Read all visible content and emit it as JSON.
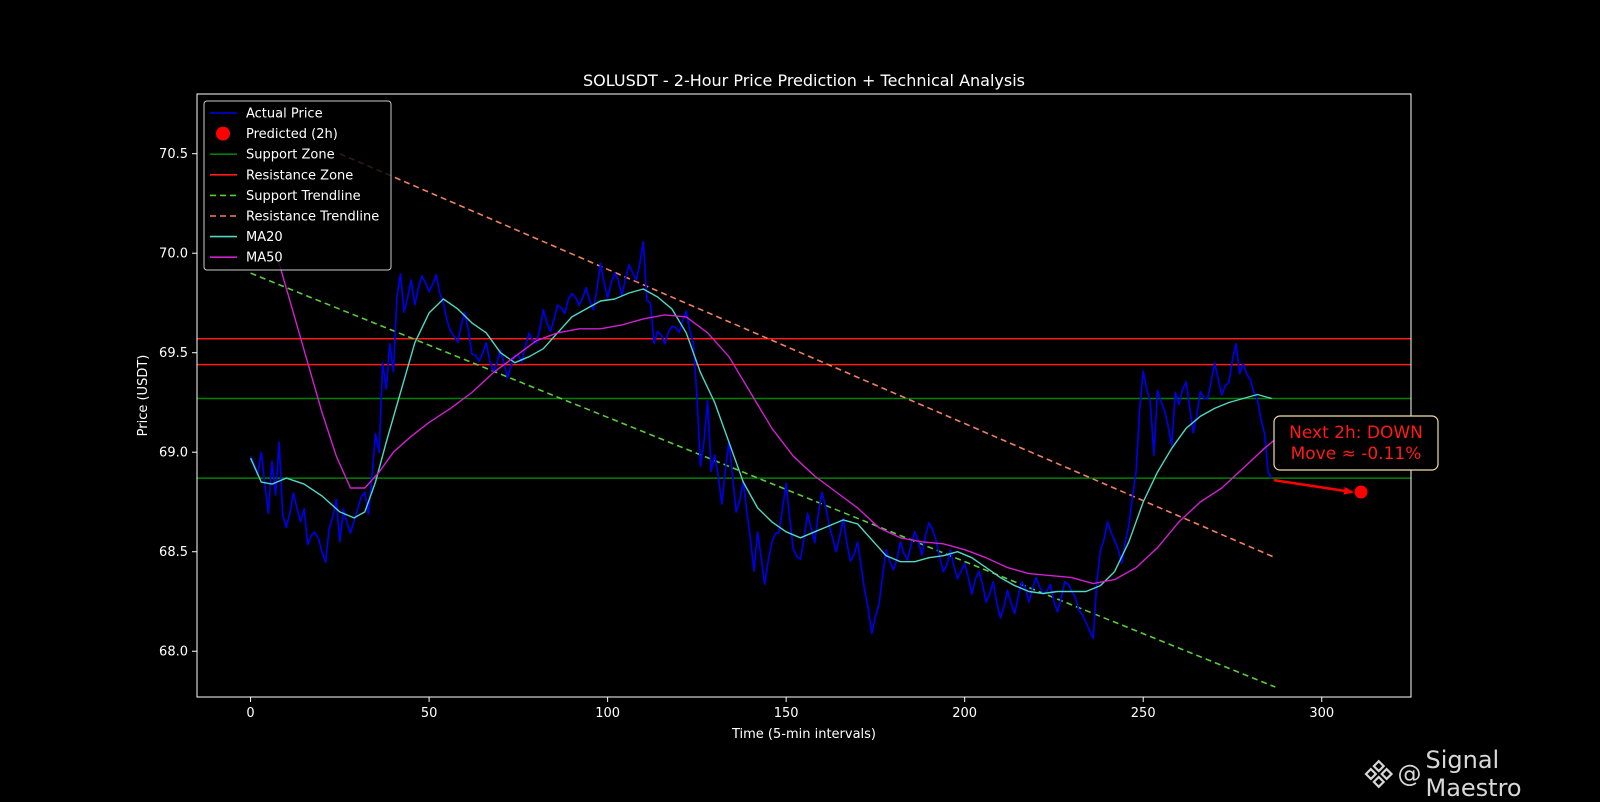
{
  "chart_data": {
    "type": "line",
    "title": "SOLUSDT - 2-Hour Price Prediction + Technical Analysis",
    "xlabel": "Time (5-min intervals)",
    "ylabel": "Price (USDT)",
    "xlim": [
      -15,
      325
    ],
    "ylim": [
      67.77,
      70.8
    ],
    "xticks": [
      0,
      50,
      100,
      150,
      200,
      250,
      300
    ],
    "yticks": [
      68.0,
      68.5,
      69.0,
      69.5,
      70.0,
      70.5
    ],
    "ytick_labels": [
      "68.0",
      "68.5",
      "69.0",
      "69.5",
      "70.0",
      "70.5"
    ],
    "grid": false,
    "legend_position": "top-left",
    "legend": [
      "Actual Price",
      "Predicted (2h)",
      "Support Zone",
      "Resistance Zone",
      "Support Trendline",
      "Resistance Trendline",
      "MA20",
      "MA50"
    ],
    "colors": {
      "actual": "#0000e6",
      "predicted": "#ff0000",
      "support_zone": "#008000",
      "resistance_zone": "#ff1a1a",
      "support_trend": "#5acb3c",
      "resistance_trend": "#f08060",
      "ma20": "#4fd8c4",
      "ma50": "#d020d0"
    },
    "actual_price_anchors": [
      [
        0,
        68.97
      ],
      [
        2,
        68.9
      ],
      [
        3,
        69.0
      ],
      [
        4,
        68.85
      ],
      [
        5,
        68.68
      ],
      [
        6,
        68.95
      ],
      [
        7,
        68.78
      ],
      [
        8,
        69.05
      ],
      [
        9,
        68.7
      ],
      [
        10,
        68.62
      ],
      [
        12,
        68.78
      ],
      [
        14,
        68.65
      ],
      [
        15,
        68.72
      ],
      [
        16,
        68.55
      ],
      [
        18,
        68.6
      ],
      [
        20,
        68.5
      ],
      [
        21,
        68.45
      ],
      [
        22,
        68.62
      ],
      [
        24,
        68.75
      ],
      [
        25,
        68.55
      ],
      [
        26,
        68.7
      ],
      [
        28,
        68.6
      ],
      [
        30,
        68.72
      ],
      [
        32,
        68.8
      ],
      [
        33,
        68.68
      ],
      [
        35,
        69.1
      ],
      [
        36,
        69.0
      ],
      [
        37,
        69.45
      ],
      [
        38,
        69.3
      ],
      [
        39,
        69.55
      ],
      [
        40,
        69.4
      ],
      [
        41,
        69.8
      ],
      [
        42,
        69.9
      ],
      [
        43,
        69.7
      ],
      [
        45,
        69.85
      ],
      [
        46,
        69.75
      ],
      [
        48,
        69.9
      ],
      [
        50,
        69.8
      ],
      [
        52,
        69.88
      ],
      [
        54,
        69.75
      ],
      [
        56,
        69.6
      ],
      [
        58,
        69.55
      ],
      [
        60,
        69.72
      ],
      [
        62,
        69.5
      ],
      [
        64,
        69.45
      ],
      [
        66,
        69.55
      ],
      [
        68,
        69.4
      ],
      [
        70,
        69.5
      ],
      [
        72,
        69.38
      ],
      [
        74,
        69.5
      ],
      [
        76,
        69.45
      ],
      [
        78,
        69.6
      ],
      [
        80,
        69.55
      ],
      [
        82,
        69.7
      ],
      [
        84,
        69.6
      ],
      [
        86,
        69.75
      ],
      [
        88,
        69.7
      ],
      [
        90,
        69.8
      ],
      [
        92,
        69.75
      ],
      [
        94,
        69.82
      ],
      [
        96,
        69.7
      ],
      [
        98,
        69.95
      ],
      [
        100,
        69.78
      ],
      [
        102,
        69.9
      ],
      [
        104,
        69.8
      ],
      [
        106,
        69.95
      ],
      [
        108,
        69.85
      ],
      [
        110,
        70.05
      ],
      [
        111,
        69.78
      ],
      [
        112,
        69.75
      ],
      [
        113,
        69.55
      ],
      [
        114,
        69.6
      ],
      [
        116,
        69.55
      ],
      [
        118,
        69.65
      ],
      [
        120,
        69.6
      ],
      [
        122,
        69.7
      ],
      [
        124,
        69.55
      ],
      [
        125,
        69.3
      ],
      [
        126,
        68.92
      ],
      [
        127,
        69.05
      ],
      [
        128,
        69.25
      ],
      [
        129,
        68.9
      ],
      [
        130,
        69.0
      ],
      [
        132,
        68.75
      ],
      [
        134,
        69.05
      ],
      [
        136,
        68.7
      ],
      [
        138,
        68.85
      ],
      [
        140,
        68.55
      ],
      [
        141,
        68.4
      ],
      [
        142,
        68.6
      ],
      [
        144,
        68.35
      ],
      [
        146,
        68.55
      ],
      [
        148,
        68.6
      ],
      [
        150,
        68.85
      ],
      [
        152,
        68.5
      ],
      [
        154,
        68.45
      ],
      [
        156,
        68.7
      ],
      [
        158,
        68.55
      ],
      [
        160,
        68.8
      ],
      [
        162,
        68.65
      ],
      [
        164,
        68.5
      ],
      [
        166,
        68.65
      ],
      [
        168,
        68.45
      ],
      [
        170,
        68.55
      ],
      [
        172,
        68.3
      ],
      [
        174,
        68.1
      ],
      [
        176,
        68.25
      ],
      [
        178,
        68.5
      ],
      [
        180,
        68.4
      ],
      [
        182,
        68.55
      ],
      [
        184,
        68.45
      ],
      [
        186,
        68.6
      ],
      [
        188,
        68.5
      ],
      [
        190,
        68.65
      ],
      [
        192,
        68.55
      ],
      [
        194,
        68.4
      ],
      [
        196,
        68.5
      ],
      [
        198,
        68.35
      ],
      [
        200,
        68.45
      ],
      [
        202,
        68.3
      ],
      [
        204,
        68.4
      ],
      [
        206,
        68.25
      ],
      [
        208,
        68.35
      ],
      [
        210,
        68.15
      ],
      [
        212,
        68.3
      ],
      [
        214,
        68.2
      ],
      [
        216,
        68.35
      ],
      [
        218,
        68.25
      ],
      [
        220,
        68.38
      ],
      [
        222,
        68.28
      ],
      [
        224,
        68.32
      ],
      [
        226,
        68.2
      ],
      [
        228,
        68.35
      ],
      [
        230,
        68.3
      ],
      [
        232,
        68.22
      ],
      [
        234,
        68.15
      ],
      [
        236,
        68.05
      ],
      [
        237,
        68.35
      ],
      [
        238,
        68.5
      ],
      [
        240,
        68.65
      ],
      [
        242,
        68.55
      ],
      [
        244,
        68.45
      ],
      [
        246,
        68.65
      ],
      [
        248,
        68.9
      ],
      [
        249,
        69.2
      ],
      [
        250,
        69.4
      ],
      [
        252,
        69.25
      ],
      [
        253,
        69.0
      ],
      [
        254,
        69.3
      ],
      [
        256,
        69.2
      ],
      [
        258,
        69.05
      ],
      [
        259,
        69.3
      ],
      [
        260,
        69.25
      ],
      [
        262,
        69.35
      ],
      [
        264,
        69.1
      ],
      [
        266,
        69.3
      ],
      [
        268,
        69.25
      ],
      [
        270,
        69.45
      ],
      [
        272,
        69.3
      ],
      [
        274,
        69.35
      ],
      [
        276,
        69.55
      ],
      [
        277,
        69.4
      ],
      [
        278,
        69.45
      ],
      [
        280,
        69.35
      ],
      [
        282,
        69.25
      ],
      [
        284,
        69.1
      ],
      [
        285,
        68.9
      ],
      [
        286,
        68.87
      ]
    ],
    "ma20_anchors": [
      [
        0,
        68.97
      ],
      [
        3,
        68.85
      ],
      [
        6,
        68.84
      ],
      [
        10,
        68.87
      ],
      [
        15,
        68.84
      ],
      [
        20,
        68.78
      ],
      [
        25,
        68.7
      ],
      [
        29,
        68.67
      ],
      [
        32,
        68.7
      ],
      [
        35,
        68.85
      ],
      [
        38,
        69.05
      ],
      [
        42,
        69.3
      ],
      [
        46,
        69.55
      ],
      [
        50,
        69.7
      ],
      [
        54,
        69.77
      ],
      [
        58,
        69.72
      ],
      [
        62,
        69.65
      ],
      [
        66,
        69.6
      ],
      [
        70,
        69.5
      ],
      [
        74,
        69.45
      ],
      [
        78,
        69.48
      ],
      [
        82,
        69.52
      ],
      [
        86,
        69.6
      ],
      [
        90,
        69.68
      ],
      [
        94,
        69.72
      ],
      [
        98,
        69.76
      ],
      [
        102,
        69.77
      ],
      [
        106,
        69.8
      ],
      [
        110,
        69.82
      ],
      [
        114,
        69.78
      ],
      [
        118,
        69.72
      ],
      [
        122,
        69.6
      ],
      [
        126,
        69.4
      ],
      [
        130,
        69.25
      ],
      [
        134,
        69.05
      ],
      [
        138,
        68.85
      ],
      [
        142,
        68.72
      ],
      [
        146,
        68.65
      ],
      [
        150,
        68.6
      ],
      [
        154,
        68.57
      ],
      [
        158,
        68.6
      ],
      [
        162,
        68.63
      ],
      [
        166,
        68.66
      ],
      [
        170,
        68.64
      ],
      [
        174,
        68.56
      ],
      [
        178,
        68.48
      ],
      [
        182,
        68.45
      ],
      [
        186,
        68.45
      ],
      [
        190,
        68.47
      ],
      [
        194,
        68.48
      ],
      [
        198,
        68.5
      ],
      [
        202,
        68.47
      ],
      [
        206,
        68.42
      ],
      [
        210,
        68.37
      ],
      [
        214,
        68.33
      ],
      [
        218,
        68.3
      ],
      [
        222,
        68.29
      ],
      [
        226,
        68.3
      ],
      [
        230,
        68.3
      ],
      [
        234,
        68.3
      ],
      [
        238,
        68.33
      ],
      [
        242,
        68.4
      ],
      [
        246,
        68.55
      ],
      [
        250,
        68.75
      ],
      [
        254,
        68.9
      ],
      [
        258,
        69.02
      ],
      [
        262,
        69.12
      ],
      [
        266,
        69.18
      ],
      [
        270,
        69.22
      ],
      [
        274,
        69.25
      ],
      [
        278,
        69.27
      ],
      [
        282,
        69.29
      ],
      [
        286,
        69.27
      ]
    ],
    "ma50_anchors": [
      [
        8,
        69.95
      ],
      [
        12,
        69.7
      ],
      [
        16,
        69.45
      ],
      [
        20,
        69.2
      ],
      [
        24,
        68.98
      ],
      [
        28,
        68.82
      ],
      [
        32,
        68.82
      ],
      [
        36,
        68.9
      ],
      [
        40,
        69.0
      ],
      [
        45,
        69.08
      ],
      [
        50,
        69.15
      ],
      [
        56,
        69.22
      ],
      [
        62,
        69.3
      ],
      [
        68,
        69.4
      ],
      [
        74,
        69.48
      ],
      [
        80,
        69.56
      ],
      [
        86,
        69.6
      ],
      [
        92,
        69.62
      ],
      [
        98,
        69.62
      ],
      [
        104,
        69.64
      ],
      [
        110,
        69.67
      ],
      [
        116,
        69.69
      ],
      [
        122,
        69.68
      ],
      [
        128,
        69.6
      ],
      [
        134,
        69.48
      ],
      [
        140,
        69.3
      ],
      [
        146,
        69.12
      ],
      [
        152,
        68.98
      ],
      [
        158,
        68.88
      ],
      [
        164,
        68.8
      ],
      [
        170,
        68.72
      ],
      [
        176,
        68.62
      ],
      [
        182,
        68.57
      ],
      [
        188,
        68.55
      ],
      [
        194,
        68.54
      ],
      [
        200,
        68.51
      ],
      [
        206,
        68.47
      ],
      [
        212,
        68.42
      ],
      [
        218,
        68.39
      ],
      [
        224,
        68.38
      ],
      [
        230,
        68.37
      ],
      [
        236,
        68.34
      ],
      [
        242,
        68.36
      ],
      [
        248,
        68.42
      ],
      [
        254,
        68.52
      ],
      [
        260,
        68.65
      ],
      [
        266,
        68.75
      ],
      [
        272,
        68.82
      ],
      [
        278,
        68.92
      ],
      [
        284,
        69.02
      ],
      [
        288,
        69.08
      ]
    ],
    "support_zones": [
      68.87,
      69.27
    ],
    "resistance_zones": [
      69.44,
      69.57
    ],
    "support_trendline": [
      [
        0,
        69.9
      ],
      [
        287,
        67.82
      ]
    ],
    "resistance_trendline": [
      [
        25,
        70.5
      ],
      [
        287,
        68.47
      ]
    ],
    "last_price": {
      "x": 286,
      "y": 68.87
    },
    "predicted": {
      "x": 311,
      "y": 68.8
    },
    "annotation": {
      "line1": "Next 2h: DOWN",
      "line2": "Move ≈ -0.11%"
    }
  },
  "watermark": {
    "at": "@",
    "text": "Signal Maestro"
  }
}
